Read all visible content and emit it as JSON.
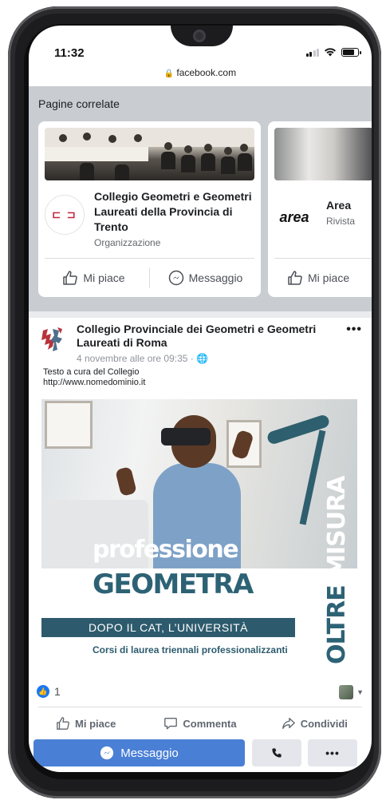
{
  "status_bar": {
    "time": "11:32",
    "signal_bars_filled": 2,
    "battery_level": 0.85
  },
  "browser": {
    "url": "facebook.com",
    "lock_icon": "lock-icon"
  },
  "related": {
    "title": "Pagine correlate",
    "cards": [
      {
        "name": "Collegio Geometri e Geometri Laureati della Provincia di Trento",
        "type": "Organizzazione",
        "logo_text": "⊏ ⊐",
        "like_label": "Mi piace",
        "message_label": "Messaggio"
      },
      {
        "name": "Area",
        "type": "Rivista",
        "logo_text": "area",
        "like_label": "Mi piace"
      }
    ]
  },
  "post": {
    "author": "Collegio Provinciale dei Geometri e Geometri Laureati di Roma",
    "date": "4 novembre alle ore 09:35 · ",
    "text_line_1": "Testo a cura del Collegio",
    "text_line_2": "http://www.nomedominio.it",
    "more_label": "•••",
    "image": {
      "title_1": "professione",
      "title_2": "GEOMETRA",
      "vertical_1": "OLTRE",
      "vertical_2": " MISURA",
      "band": "DOPO IL CAT, L’UNIVERSITÀ",
      "subtitle": "Corsi di laurea triennali professionalizzanti"
    },
    "reactions_count": "1",
    "actions": {
      "like": "Mi piace",
      "comment": "Commenta",
      "share": "Condividi"
    }
  },
  "bottom_bar": {
    "message": "Messaggio",
    "call_icon": "phone-icon",
    "more": "•••"
  },
  "colors": {
    "facebook_blue": "#1877f2",
    "message_button": "#4a7fd6",
    "related_background": "#c9ccd1",
    "poster_teal": "#2d5b6d"
  }
}
